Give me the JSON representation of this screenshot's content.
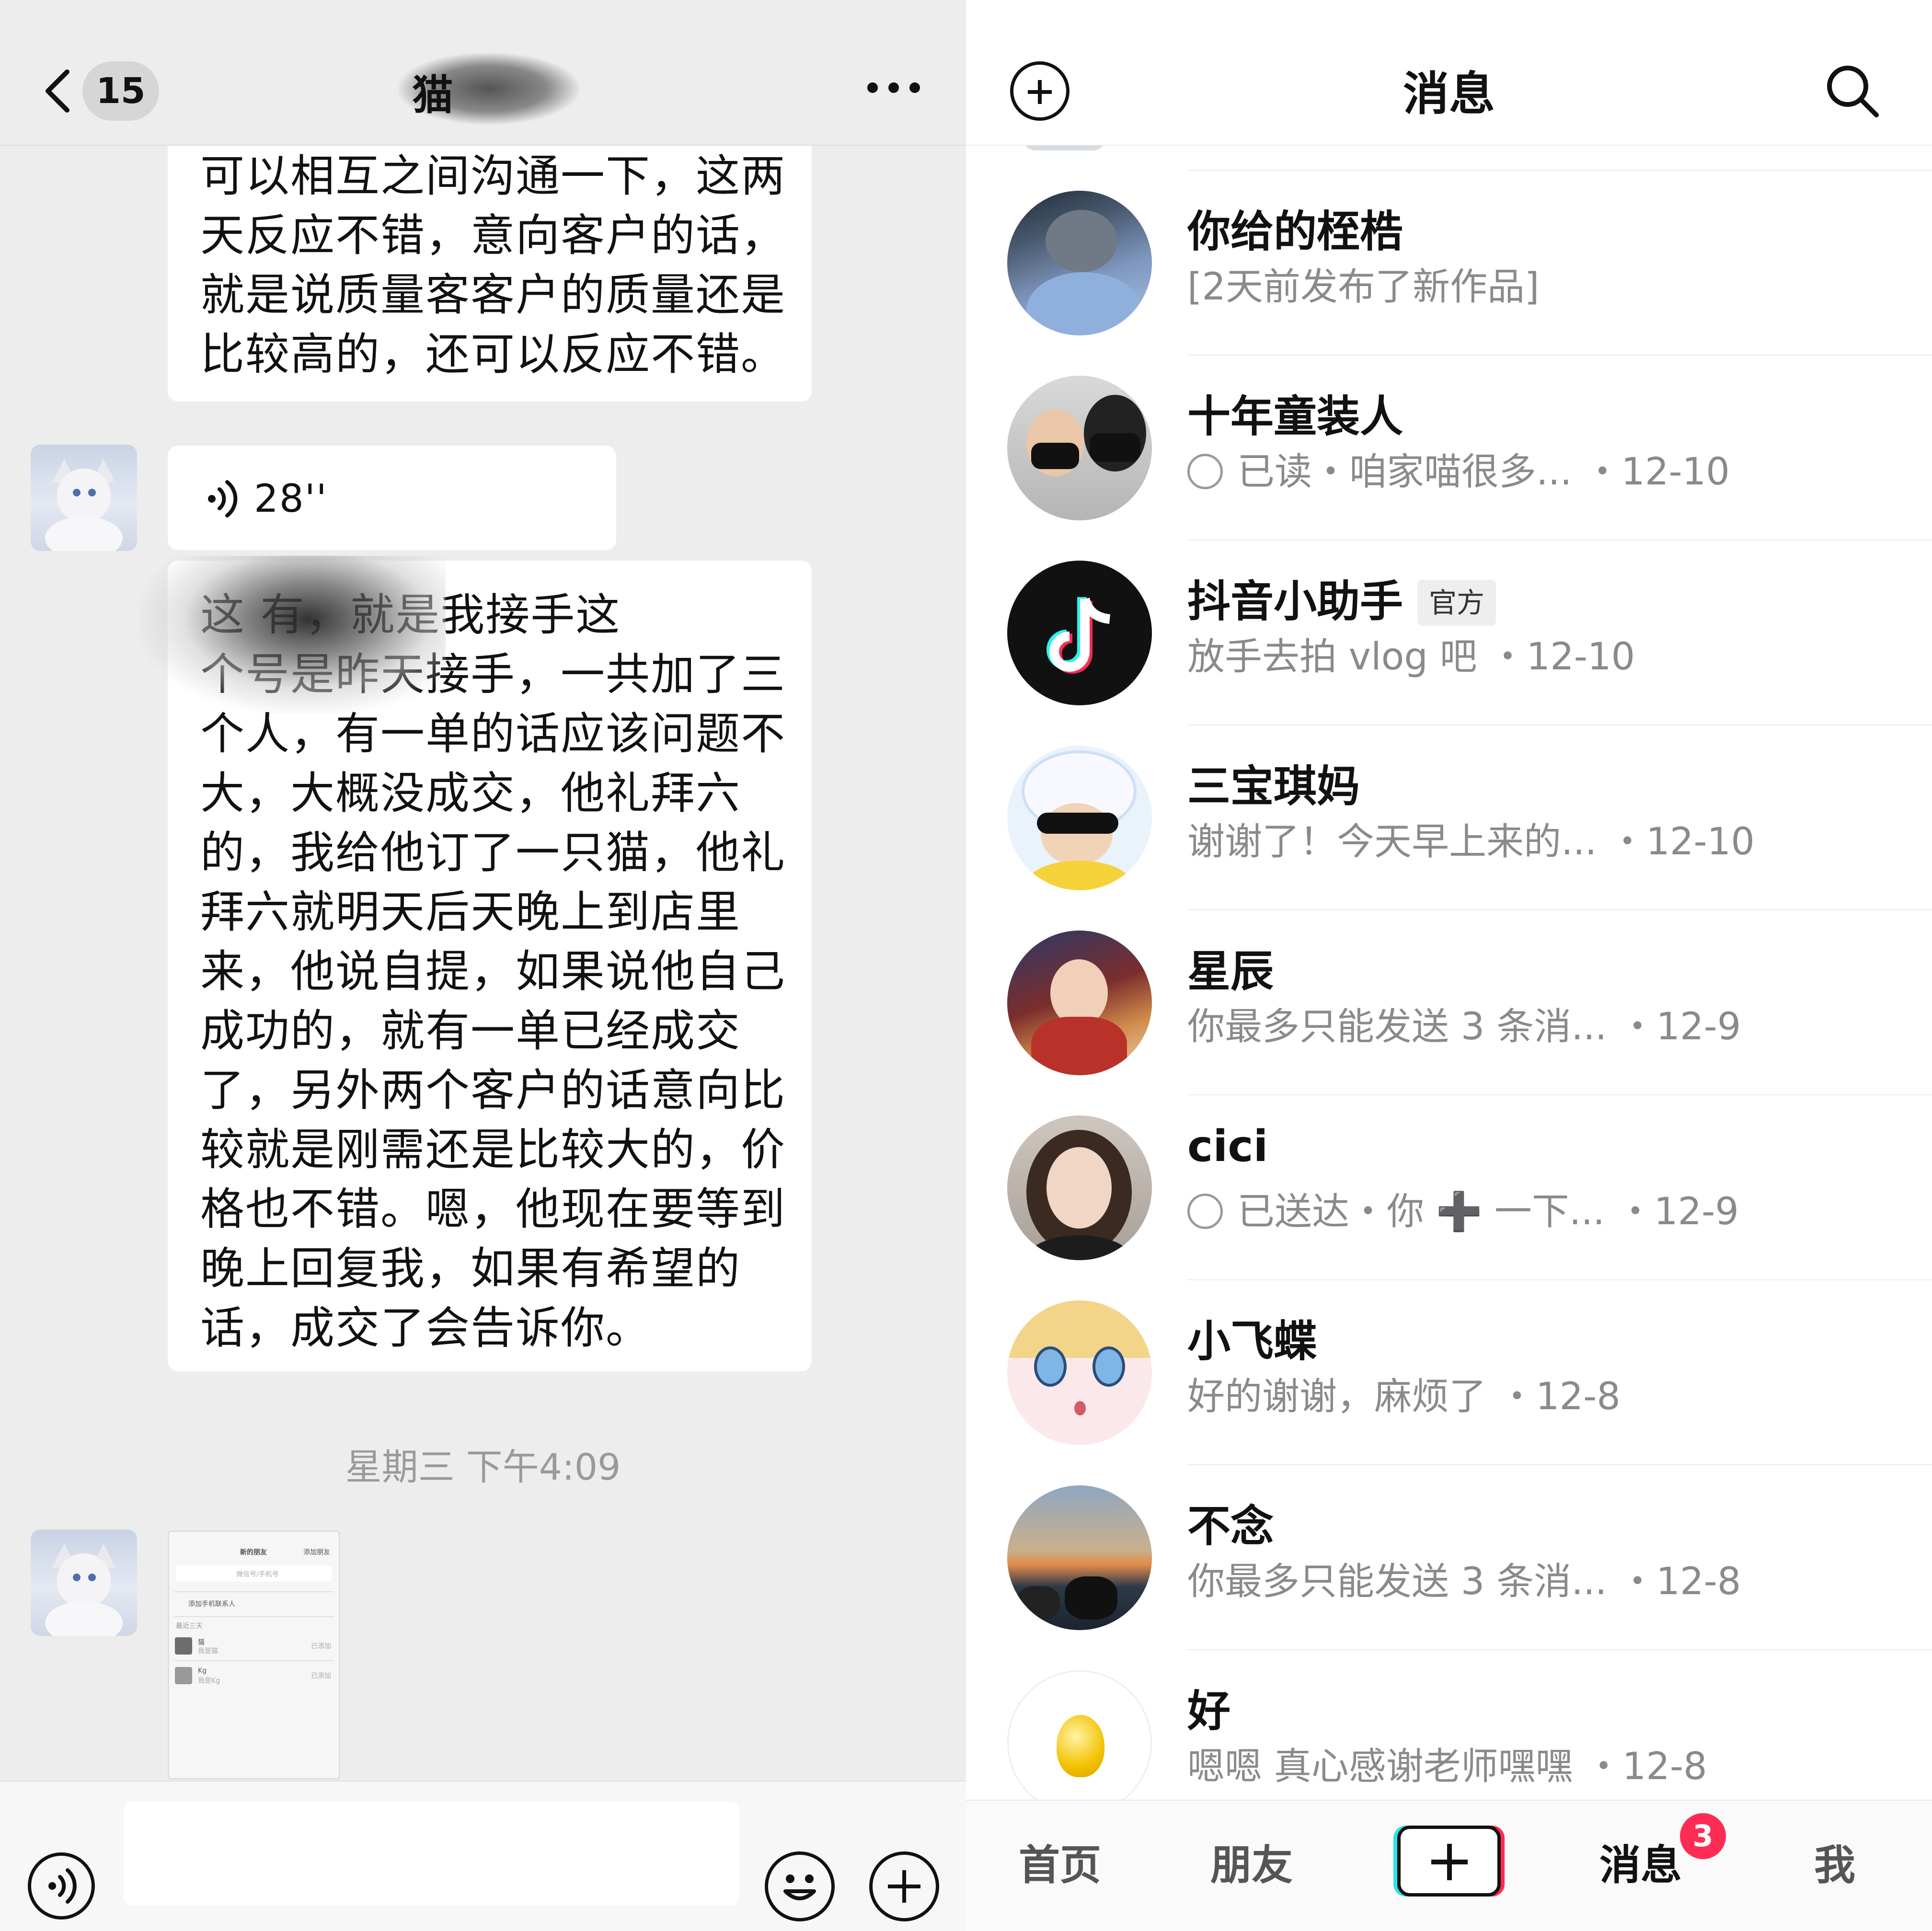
{
  "chat": {
    "unread_count": "15",
    "title": "猫",
    "top_bubble_lines": [
      "可以相互之间沟通一下，这两",
      "天反应不错，意向客户的话，",
      "就是说质量客客户的质量还是",
      "比较高的，还可以反应不错。"
    ],
    "voice_duration": "28''",
    "long_bubble_lines": [
      "这        有，就是我接手这",
      "个号是昨天接手，一共加了三",
      "个人，有一单的话应该问题不",
      "大，大概没成交，他礼拜六",
      "的，我给他订了一只猫，他礼",
      "拜六就明天后天晚上到店里",
      "来，他说自提，如果说他自己",
      "成功的，就有一单已经成交",
      "了，另外两个客户的话意向比",
      "较就是刚需还是比较大的，价",
      "格也不错。嗯，他现在要等到",
      "晚上回复我，如果有希望的",
      "话，成交了会告诉你。"
    ],
    "timestamp": "星期三 下午4:09",
    "thumbnail": {
      "title": "新的朋友",
      "right": "添加朋友",
      "search": "微信号/手机号",
      "add_contacts": "添加手机联系人",
      "section": "最近三天",
      "rows": [
        {
          "name": "猫",
          "sub": "我是猫",
          "status": "已添加"
        },
        {
          "name": "Kg",
          "sub": "我是Kg",
          "status": "已添加"
        }
      ]
    }
  },
  "messages": {
    "title": "消息",
    "conversations": [
      {
        "name": "你给的桎梏",
        "preview": "[2天前发布了新作品]",
        "date": ""
      },
      {
        "name": "十年童装人",
        "status": "已读",
        "preview": "已读・咱家喵很多...",
        "date": "・12-10"
      },
      {
        "name": "抖音小助手",
        "tag": "官方",
        "preview": "放手去拍 vlog 吧",
        "date": "・12-10"
      },
      {
        "name": "三宝琪妈",
        "preview": "谢谢了！今天早上来的...",
        "date": "・12-10"
      },
      {
        "name": "星辰",
        "preview": "你最多只能发送 3 条消...",
        "date": "・12-9"
      },
      {
        "name": "cici",
        "status": "已送达",
        "preview": "已送达・你 ➕ 一下...",
        "date": "・12-9"
      },
      {
        "name": "小飞蝶",
        "preview": "好的谢谢，麻烦了",
        "date": "・12-8"
      },
      {
        "name": "不念",
        "preview": "你最多只能发送 3 条消...",
        "date": "・12-8"
      },
      {
        "name": "好",
        "preview": "嗯嗯 真心感谢老师嘿嘿",
        "date": "・12-8"
      }
    ],
    "tabs": {
      "home": "首页",
      "friends": "朋友",
      "messages": "消息",
      "me": "我"
    },
    "badge": "3"
  },
  "colors": {
    "accent_red": "#fe2c55",
    "accent_cyan": "#2de2e6",
    "chat_bg": "#ededed"
  },
  "icons": [
    "back-arrow-icon",
    "more-icon",
    "voice-icon",
    "emoji-icon",
    "plus-icon",
    "search-icon",
    "tiktok-logo-icon"
  ]
}
